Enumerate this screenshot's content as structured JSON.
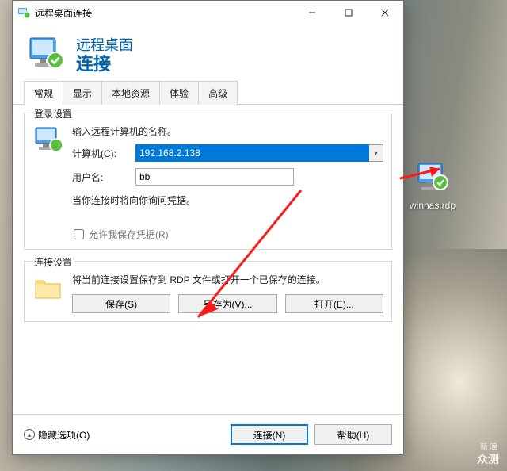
{
  "window": {
    "title": "远程桌面连接",
    "banner_line1": "远程桌面",
    "banner_line2": "连接"
  },
  "tabs": [
    "常规",
    "显示",
    "本地资源",
    "体验",
    "高级"
  ],
  "active_tab_index": 0,
  "login_group": {
    "title": "登录设置",
    "prompt": "输入远程计算机的名称。",
    "computer_label": "计算机(C):",
    "computer_value": "192.168.2.138",
    "username_label": "用户名:",
    "username_value": "bb",
    "hint": "当你连接时将向你询问凭据。",
    "checkbox_label": "允许我保存凭据(R)"
  },
  "conn_group": {
    "title": "连接设置",
    "desc": "将当前连接设置保存到 RDP 文件或打开一个已保存的连接。",
    "save_btn": "保存(S)",
    "saveas_btn": "另存为(V)...",
    "open_btn": "打开(E)..."
  },
  "footer": {
    "hide_options": "隐藏选项(O)",
    "connect": "连接(N)",
    "help": "帮助(H)"
  },
  "desktop_file": "winnas.rdp",
  "watermark": {
    "l1": "新浪",
    "l2": "众测"
  }
}
